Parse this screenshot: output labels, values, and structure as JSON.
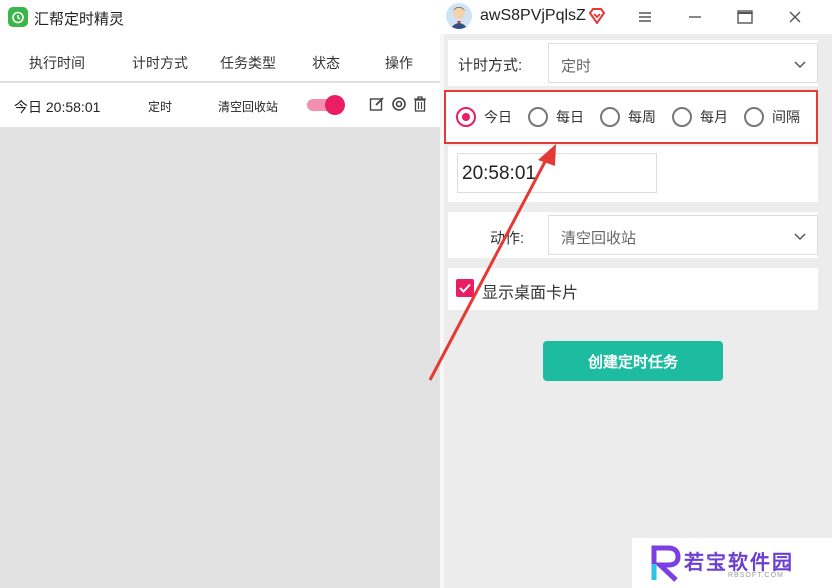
{
  "app": {
    "title": "汇帮定时精灵",
    "user": "awS8PVjPqlsZ"
  },
  "window_controls": {
    "menu": "≡",
    "minimize": "—",
    "maximize": "☐",
    "close": "✕"
  },
  "task_table": {
    "headers": [
      "执行时间",
      "计时方式",
      "任务类型",
      "状态",
      "操作"
    ],
    "rows": [
      {
        "time": "今日 20:58:01",
        "mode": "定时",
        "type": "清空回收站",
        "enabled": true
      }
    ]
  },
  "form": {
    "timing_label": "计时方式:",
    "timing_value": "定时",
    "radio_options": [
      "今日",
      "每日",
      "每周",
      "每月",
      "间隔"
    ],
    "radio_selected": "今日",
    "time_value": "20:58:01",
    "action_label": "动作:",
    "action_value": "清空回收站",
    "show_card_label": "显示桌面卡片",
    "show_card_checked": true,
    "create_button": "创建定时任务"
  },
  "watermark": {
    "text": "若宝软件园",
    "sub": "RBSOFT.COM"
  },
  "colors": {
    "accent": "#e91e63",
    "primary_button": "#1dbb9f",
    "highlight": "#e53935"
  }
}
